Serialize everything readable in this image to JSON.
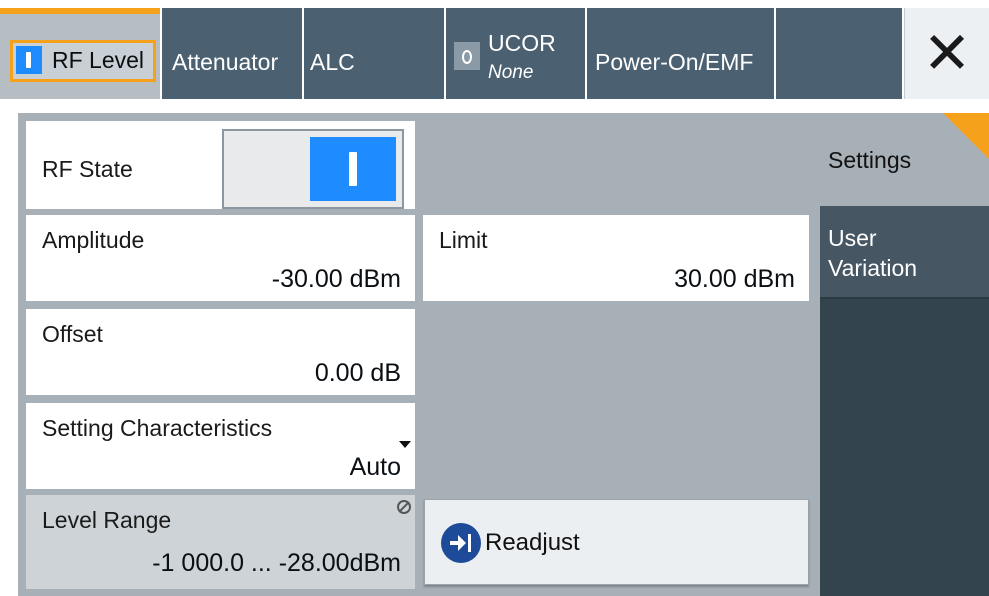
{
  "tabs": [
    {
      "label": "RF Level",
      "active": true
    },
    {
      "label": "Attenuator"
    },
    {
      "label": "ALC"
    },
    {
      "label": "UCOR",
      "sublabel": "None"
    },
    {
      "label": "Power-On/EMF"
    }
  ],
  "close_icon": "close-icon",
  "fields": {
    "rf_state": {
      "label": "RF State",
      "value": "on"
    },
    "amplitude": {
      "label": "Amplitude",
      "value": "-30.00 dBm"
    },
    "limit": {
      "label": "Limit",
      "value": "30.00 dBm"
    },
    "offset": {
      "label": "Offset",
      "value": "0.00 dB"
    },
    "setting_characteristics": {
      "label": "Setting Characteristics",
      "value": "Auto"
    },
    "level_range": {
      "label": "Level Range",
      "value": "-1 000.0 ... -28.00dBm"
    }
  },
  "buttons": {
    "readjust": "Readjust"
  },
  "side_panel": {
    "settings": "Settings",
    "user_variation": "User Variation"
  },
  "colors": {
    "accent": "#f5a11c",
    "toggle_on": "#1e8cff",
    "tab_bg": "#4b6171",
    "panel_bg": "#a7b0b7",
    "side_dark": "#34444f"
  }
}
